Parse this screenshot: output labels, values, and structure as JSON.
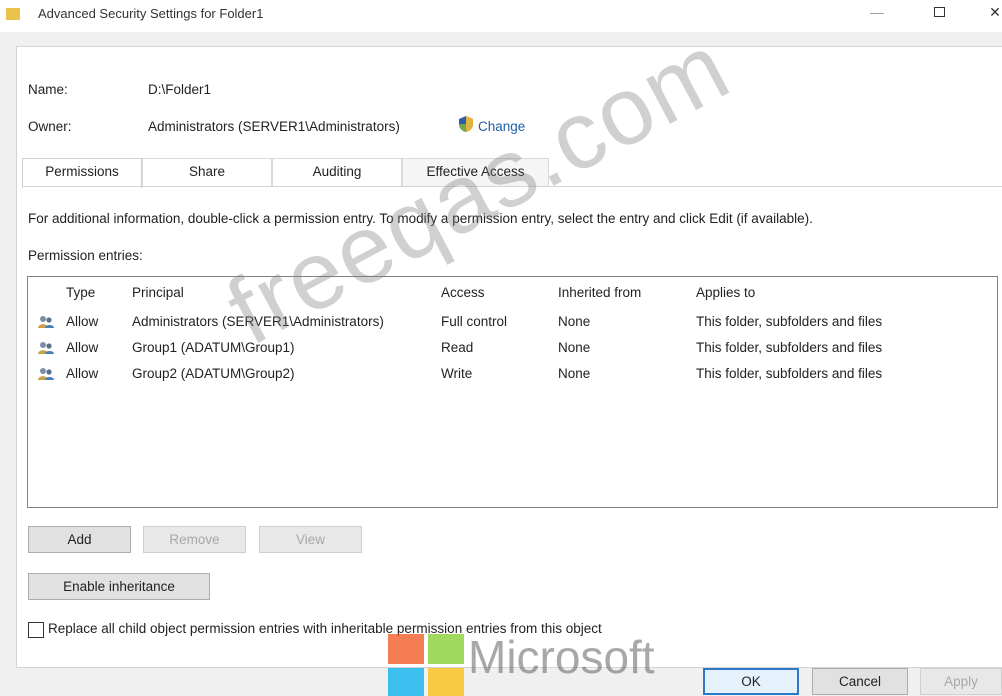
{
  "window": {
    "title": "Advanced Security Settings for Folder1",
    "min_glyph": "—",
    "close_glyph": "✕"
  },
  "object": {
    "name_label": "Name:",
    "name_value": "D:\\Folder1",
    "owner_label": "Owner:",
    "owner_value": "Administrators (SERVER1\\Administrators)",
    "change_link": "Change"
  },
  "tabs": [
    {
      "label": "Permissions",
      "active": true
    },
    {
      "label": "Share",
      "active": false
    },
    {
      "label": "Auditing",
      "active": false
    },
    {
      "label": "Effective Access",
      "active": false
    }
  ],
  "info_text": "For additional information, double-click a permission entry. To modify a permission entry, select the entry and click Edit (if available).",
  "entries_label": "Permission entries:",
  "columns": {
    "type": "Type",
    "principal": "Principal",
    "access": "Access",
    "inherited": "Inherited from",
    "applies": "Applies to"
  },
  "entries": [
    {
      "type": "Allow",
      "principal": "Administrators (SERVER1\\Administrators)",
      "access": "Full control",
      "inherited": "None",
      "applies": "This folder, subfolders and files"
    },
    {
      "type": "Allow",
      "principal": "Group1 (ADATUM\\Group1)",
      "access": "Read",
      "inherited": "None",
      "applies": "This folder, subfolders and files"
    },
    {
      "type": "Allow",
      "principal": "Group2 (ADATUM\\Group2)",
      "access": "Write",
      "inherited": "None",
      "applies": "This folder, subfolders and files"
    }
  ],
  "buttons": {
    "add": "Add",
    "remove": "Remove",
    "view": "View",
    "enable_inheritance": "Enable inheritance",
    "ok": "OK",
    "cancel": "Cancel",
    "apply": "Apply"
  },
  "replace_checkbox": {
    "label": "Replace all child object permission entries with inheritable permission entries from this object",
    "checked": false
  },
  "watermark": {
    "text": "freeqas.com",
    "brand": "Microsoft"
  },
  "colors": {
    "link": "#1e5fa8",
    "ok_border": "#2f78c8"
  }
}
